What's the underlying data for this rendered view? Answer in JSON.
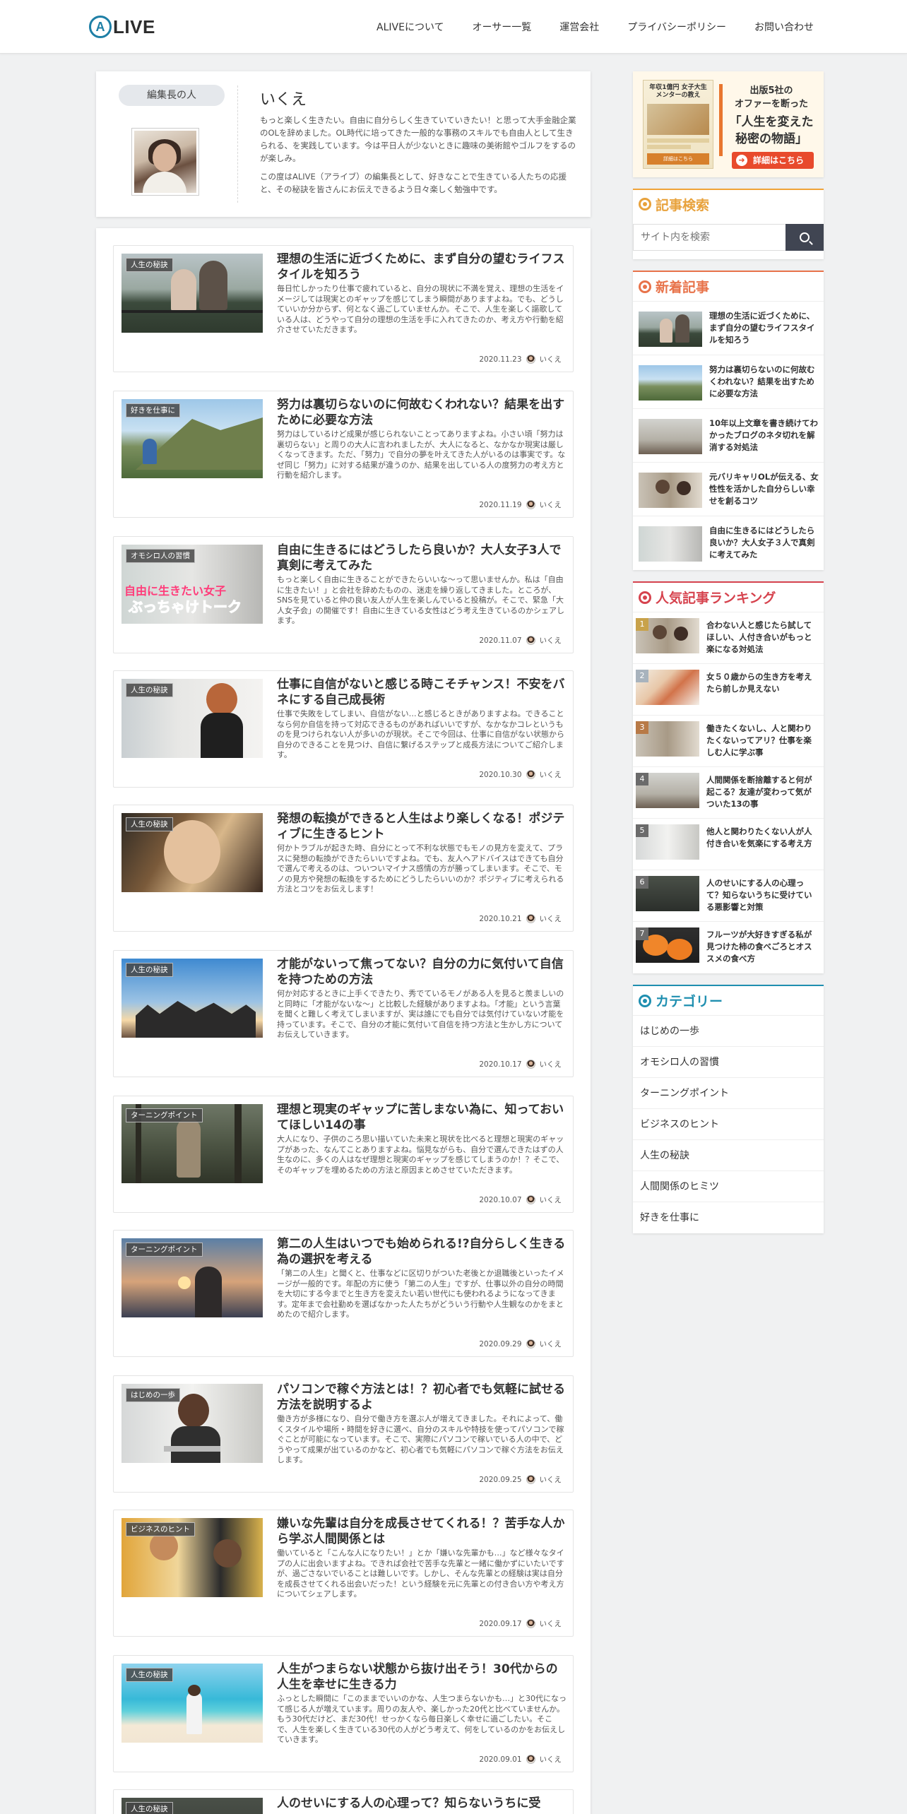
{
  "header": {
    "logo_mark": "A",
    "logo_text": "LIVE",
    "nav": [
      "ALIVEについて",
      "オーサー一覧",
      "運営会社",
      "プライバシーポリシー",
      "お問い合わせ"
    ]
  },
  "author": {
    "role": "編集長の人",
    "name": "いくえ",
    "bio1": "もっと楽しく生きたい。自由に自分らしく生きていていきたい！と思って大手金融企業のOLを辞めました。OL時代に培ってきた一般的な事務のスキルでも自由人として生きられる、を実践しています。今は平日人が少ないときに趣味の美術館やゴルフをするのが楽しみ。",
    "bio2": "この度はALIVE（アライブ）の編集長として、好きなことで生きている人たちの応援と、その秘訣を皆さんにお伝えできるよう日々楽しく勉強中です。"
  },
  "articles": [
    {
      "category": "人生の秘訣",
      "title": "理想の生活に近づくために、まず自分の望むライフスタイルを知ろう",
      "excerpt": "毎日忙しかったり仕事で疲れていると、自分の現状に不満を覚え、理想の生活をイメージしては現実とのギャップを感じてしまう瞬間がありますよね。でも、どうしていいか分からず、何となく過ごしていませんか。そこで、人生を楽しく謳歌している人は、どうやって自分の理想の生活を手に入れてきたのか、考え方や行動を紹介させていただきます。",
      "date": "2020.11.23",
      "author": "いくえ"
    },
    {
      "category": "好きを仕事に",
      "title": "努力は裏切らないのに何故むくわれない？結果を出すために必要な方法",
      "excerpt": "努力はしているけど成果が感じられないことってありますよね。小さい頃「努力は裏切らない」と周りの大人に言われましたが、大人になると、なかなか現実は厳しくなってきます。ただ、「努力」で自分の夢を叶えてきた人がいるのは事実です。なぜ同じ「努力」に対する結果が違うのか、結果を出している人の度努力の考え方と行動を紹介します。",
      "date": "2020.11.19",
      "author": "いくえ"
    },
    {
      "category": "オモシロ人の習慣",
      "title": "自由に生きるにはどうしたら良いか？大人女子3人で真剣に考えてみた",
      "excerpt": "もっと楽しく自由に生きることができたらいいな～って思いませんか。私は「自由に生きたい！」と会社を辞めたものの、迷走を繰り返してきました。ところが、SNSを見ていると仲の良い友人が人生を楽しんでいると投稿が。そこで、緊急「大人女子会」の開催です！自由に生きている女性はどう考え生きているのかシェアします。",
      "date": "2020.11.07",
      "author": "いくえ"
    },
    {
      "category": "人生の秘訣",
      "title": "仕事に自信がないと感じる時こそチャンス！不安をバネにする自己成長術",
      "excerpt": "仕事で失敗をしてしまい、自信がない…と感じるときがありますよね。できることなら何か自信を持って対応できるものがあればいいですが、なかなかコレというものを見つけられない人が多いのが現状。そこで今回は、仕事に自信がない状態から自分のできることを見つけ、自信に繋げるステップと成長方法についてご紹介します。",
      "date": "2020.10.30",
      "author": "いくえ"
    },
    {
      "category": "人生の秘訣",
      "title": "発想の転換ができると人生はより楽しくなる！ポジティブに生きるヒント",
      "excerpt": "何かトラブルが起きた時、自分にとって不利な状態でもモノの見方を変えて、プラスに発想の転換ができたらいいですよね。でも、友人へアドバイスはできても自分で選んで考えるのは、ついついマイナス感情の方が勝ってしまいます。そこで、モノの見方や発想の転換をするためにどうしたらいいのか？ポジティブに考えられる方法とコツをお伝えします！",
      "date": "2020.10.21",
      "author": "いくえ"
    },
    {
      "category": "人生の秘訣",
      "title": "才能がないって焦ってない？自分の力に気付いて自信を持つための方法",
      "excerpt": "何か対応するときに上手くできたり、秀でているモノがある人を見ると羨ましいのと同時に「才能がないな～」と比較した経験がありますよね。「才能」という言葉を聞くと難しく考えてしまいますが、実は誰にでも自分では気付けていない才能を持っています。そこで、自分の才能に気付いて自信を持つ方法と生かし方についてお伝えしていきます。",
      "date": "2020.10.17",
      "author": "いくえ"
    },
    {
      "category": "ターニングポイント",
      "title": "理想と現実のギャップに苦しまない為に、知っておいてほしい14の事",
      "excerpt": "大人になり、子供のころ思い描いていた未来と現状を比べると理想と現実のギャップがあった、なんてことありますよね。悩見ながらも、自分で選んできたはずの人生なのに、多くの人はなぜ理想と現実のギャップを感じてしまうのか！？そこで、そのギャップを埋めるための方法と原因まとめさせていただきます。",
      "date": "2020.10.07",
      "author": "いくえ"
    },
    {
      "category": "ターニングポイント",
      "title": "第二の人生はいつでも始められる!?自分らしく生きる為の選択を考える",
      "excerpt": "「第二の人生」と聞くと、仕事などに区切りがついた老後とか退職後といったイメージが一般的です。年配の方に使う「第二の人生」ですが、仕事以外の自分の時間を大切にする今までと生き方を変えたい若い世代にも使われるようになってきます。定年まで会社勤めを選ばなかった人たちがどういう行動や人生観なのかをまとめたので紹介します。",
      "date": "2020.09.29",
      "author": "いくえ"
    },
    {
      "category": "はじめの一歩",
      "title": "パソコンで稼ぐ方法とは！？初心者でも気軽に試せる方法を説明するよ",
      "excerpt": "働き方が多様になり、自分で働き方を選ぶ人が増えてきました。それによって、働くスタイルや場所・時間を好きに選べ、自分のスキルや特技を使ってパソコンで稼ぐことが可能になっています。そこで、実際にパソコンで稼いでいる人の中で、どうやって成果が出ているのかなど、初心者でも気軽にパソコンで稼ぐ方法をお伝えします。",
      "date": "2020.09.25",
      "author": "いくえ"
    },
    {
      "category": "ビジネスのヒント",
      "title": "嫌いな先輩は自分を成長させてくれる！？苦手な人から学ぶ人間関係とは",
      "excerpt": "働いていると「こんな人になりたい！」とか「嫌いな先輩かも…」など様々なタイプの人に出会いますよね。できれば会社で苦手な先輩と一緒に働かずにいたいですが、過ごさないでいることは難しいです。しかし、そんな先輩との経験は実は自分を成長させてくれる出会いだった！という経験を元に先輩との付き合い方や考え方についてシェアします。",
      "date": "2020.09.17",
      "author": "いくえ"
    },
    {
      "category": "人生の秘訣",
      "title": "人生がつまらない状態から抜け出そう！30代からの人生を幸せに生きる力",
      "excerpt": "ふっとした瞬間に「このままでいいのかな、人生つまらないかも…」と30代になって感じる人が増えています。周りの友人や、楽しかった20代と比べていませんか。もう30代だけど、まだ30代！せっかくなら毎日楽しく幸せに過ごしたい。そこで、人生を楽しく生きている30代の人がどう考えて、何をしているのかをお伝えしていきます。",
      "date": "2020.09.01",
      "author": "いくえ"
    },
    {
      "category": "人生の秘訣",
      "title": "人のせいにする人の心理って？知らないうちに受",
      "excerpt": "",
      "date": "",
      "author": ""
    }
  ],
  "sidebar": {
    "ad": {
      "book_title": "年収1億円 女子大生メンターの教え",
      "book_badge": "詳細はこちら",
      "line1": "出版5社の",
      "line2": "オファーを断った",
      "line3": "「人生を変えた",
      "line4": "秘密の物語」",
      "button": "詳細はこちら"
    },
    "search": {
      "title": "記事検索",
      "placeholder": "サイト内を検索"
    },
    "recent": {
      "title": "新着記事",
      "items": [
        "理想の生活に近づくために、まず自分の望むライフスタイルを知ろう",
        "努力は裏切らないのに何故むくわれない？結果を出すために必要な方法",
        "10年以上文章を書き続けてわかったブログのネタ切れを解消する対処法",
        "元バリキャリOLが伝える、女性性を活かした自分らしい幸せを創るコツ",
        "自由に生きるにはどうしたら良いか？大人女子３人で真剣に考えてみた"
      ]
    },
    "ranking": {
      "title": "人気記事ランキング",
      "items": [
        {
          "rank": "1",
          "title": "合わない人と感じたら試してほしい、人付き合いがもっと楽になる対処法"
        },
        {
          "rank": "2",
          "title": "女５０歳からの生き方を考えたら前しか見えない"
        },
        {
          "rank": "3",
          "title": "働きたくないし、人と関わりたくないってアリ？仕事を楽しむ人に学ぶ事"
        },
        {
          "rank": "4",
          "title": "人間関係を断捨離すると何が起こる？友達が変わって気がついた13の事"
        },
        {
          "rank": "5",
          "title": "他人と関わりたくない人が人付き合いを気楽にする考え方"
        },
        {
          "rank": "6",
          "title": "人のせいにする人の心理って？知らないうちに受けている悪影響と対策"
        },
        {
          "rank": "7",
          "title": "フルーツが大好きすぎる私が見つけた柿の食べごろとオススメの食べ方"
        }
      ]
    },
    "categories": {
      "title": "カテゴリー",
      "items": [
        "はじめの一歩",
        "オモシロ人の習慣",
        "ターニングポイント",
        "ビジネスのヒント",
        "人生の秘訣",
        "人間関係のヒミツ",
        "好きを仕事に"
      ]
    }
  },
  "colors": {
    "accent_orange": "#f0a43a",
    "accent_recent": "#e8734a",
    "accent_ranking": "#d6434e",
    "accent_category": "#1f8fb0",
    "rank_gold": "#c8a24a",
    "rank_silver": "#a8b3bd",
    "rank_bronze": "#b87a47",
    "rank_other": "#6b6b6b"
  },
  "icons": {
    "logo": "alive-logo-icon",
    "search": "search-icon",
    "widget_marker": "ring-icon",
    "author_mini": "avatar-icon",
    "ad_arrow": "arrow-right-icon"
  }
}
